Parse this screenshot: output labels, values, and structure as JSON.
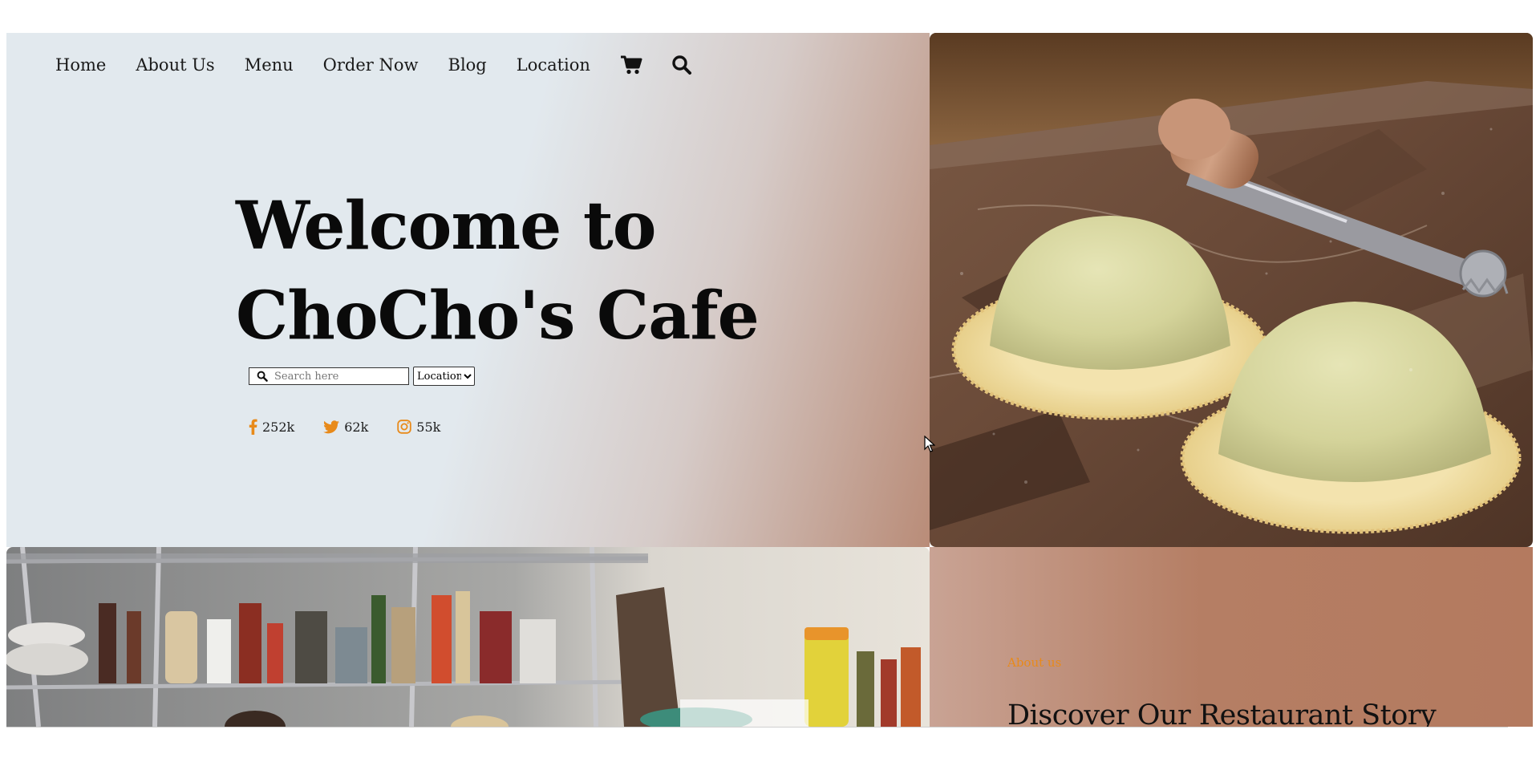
{
  "nav": {
    "items": [
      "Home",
      "About Us",
      "Menu",
      "Order Now",
      "Blog",
      "Location"
    ],
    "icons": [
      "cart-icon",
      "search-icon"
    ]
  },
  "hero": {
    "title_line1": "Welcome to",
    "title_line2": "ChoCho's Cafe"
  },
  "search": {
    "placeholder": "Search here",
    "location_selected": "Location"
  },
  "social": {
    "facebook": "252k",
    "twitter": "62k",
    "instagram": "55k"
  },
  "about": {
    "label": "About us",
    "title": "Discover Our Restaurant Story"
  },
  "colors": {
    "accent": "#e88a1a",
    "hero_bg_light": "#e2e9ee",
    "hero_bg_warm": "#b98c78",
    "about_bg": "#b57e64"
  }
}
